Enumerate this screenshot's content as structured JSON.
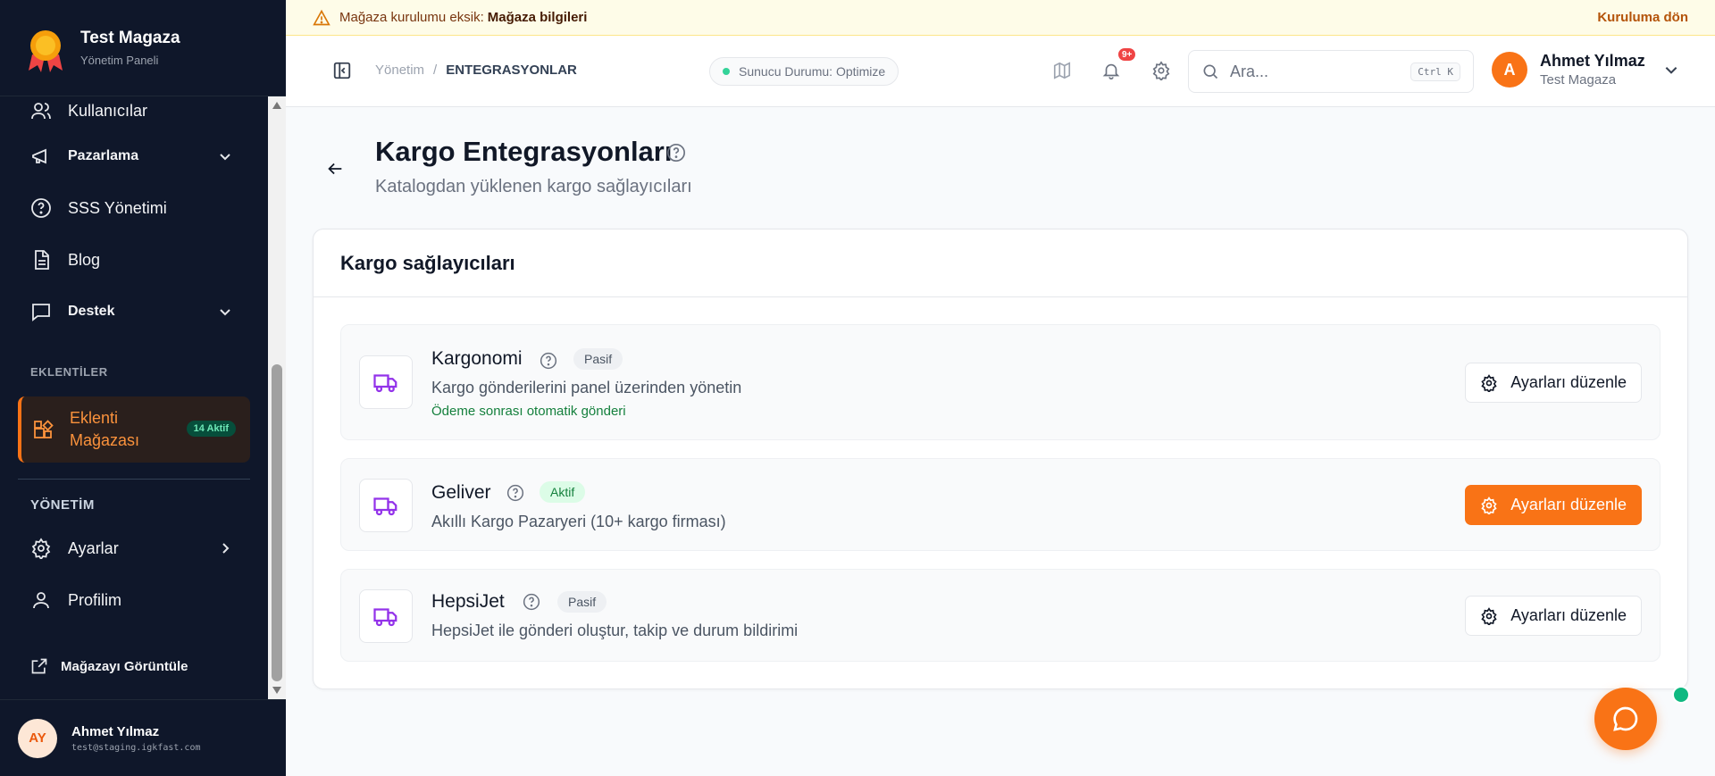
{
  "brand": {
    "title": "Test Magaza",
    "subtitle": "Yönetim Paneli"
  },
  "sidebar": {
    "items": [
      {
        "label": "Kullanıcılar",
        "icon": "users-icon"
      },
      {
        "label": "Pazarlama",
        "icon": "megaphone-icon",
        "expandable": true
      },
      {
        "label": "SSS Yönetimi",
        "icon": "help-circle-icon"
      },
      {
        "label": "Blog",
        "icon": "document-icon"
      },
      {
        "label": "Destek",
        "icon": "chat-icon",
        "expandable": true
      }
    ],
    "plugins_section": "EKLENTİLER",
    "active_plugin": {
      "label": "Eklenti Mağazası",
      "badge": "14 Aktif",
      "icon": "blocks-icon"
    },
    "admin_section": "YÖNETİM",
    "admin_items": [
      {
        "label": "Ayarlar",
        "icon": "gear-icon"
      },
      {
        "label": "Profilim",
        "icon": "user-icon"
      }
    ],
    "view_store": "Mağazayı Görüntüle",
    "user": {
      "initials": "AY",
      "name": "Ahmet Yılmaz",
      "email": "test@staging.igkfast.com"
    }
  },
  "banner": {
    "text": "Mağaza kurulumu eksik:",
    "link": "Mağaza bilgileri",
    "action": "Kuruluma dön"
  },
  "header": {
    "breadcrumb": {
      "root": "Yönetim",
      "separator": "/",
      "current": "ENTEGRASYONLAR"
    },
    "server_status": "Sunucu Durumu: Optimize",
    "notifications_badge": "9+",
    "search": {
      "placeholder": "Ara...",
      "shortcut": "Ctrl K"
    },
    "user": {
      "initial": "A",
      "name": "Ahmet Yılmaz",
      "store": "Test Magaza"
    }
  },
  "page": {
    "title": "Kargo Entegrasyonları",
    "subtitle": "Katalogdan yüklenen kargo sağlayıcıları",
    "card_title": "Kargo sağlayıcıları",
    "providers": [
      {
        "name": "Kargonomi",
        "status": "Pasif",
        "description": "Kargo gönderilerini panel üzerinden yönetin",
        "note": "Ödeme sonrası otomatik gönderi",
        "button": "Ayarları düzenle"
      },
      {
        "name": "Geliver",
        "status": "Aktif",
        "description": "Akıllı Kargo Pazaryeri (10+ kargo firması)",
        "button": "Ayarları düzenle"
      },
      {
        "name": "HepsiJet",
        "status": "Pasif",
        "description": "HepsiJet ile gönderi oluştur, takip ve durum bildirimi",
        "button": "Ayarları düzenle"
      }
    ]
  },
  "colors": {
    "accent": "#f97316",
    "sidebar_bg": "#0f172a",
    "active_green": "#15803d",
    "truck_icon": "#9333ea"
  }
}
